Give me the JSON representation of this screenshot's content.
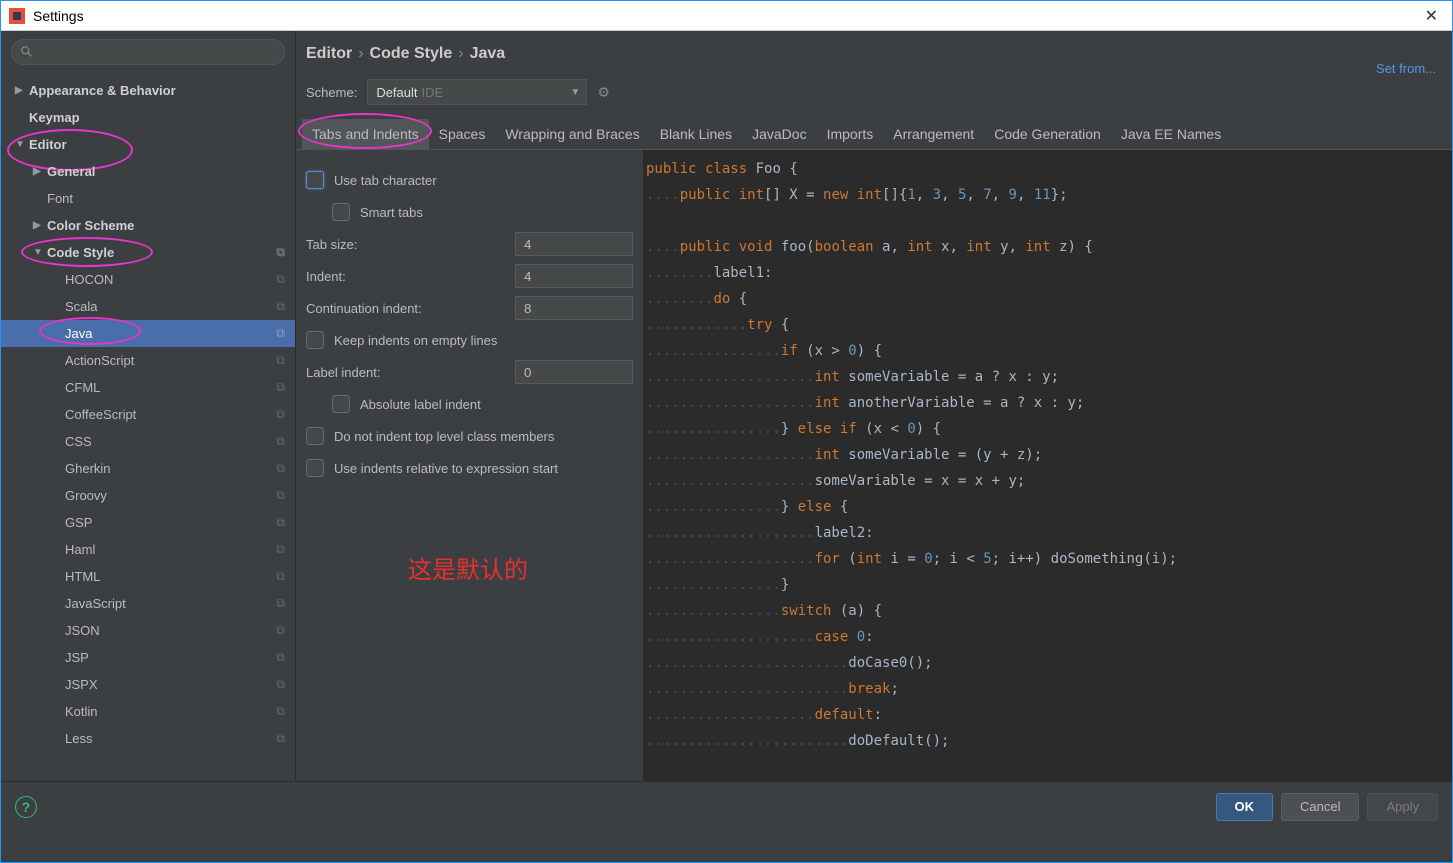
{
  "window": {
    "title": "Settings"
  },
  "breadcrumb": {
    "a": "Editor",
    "b": "Code Style",
    "c": "Java"
  },
  "scheme": {
    "label": "Scheme:",
    "value": "Default",
    "suffix": "IDE",
    "setfrom": "Set from..."
  },
  "sidebar": {
    "top": [
      {
        "label": "Appearance & Behavior",
        "arrow": "▶",
        "bold": true
      },
      {
        "label": "Keymap",
        "arrow": "",
        "bold": true
      },
      {
        "label": "Editor",
        "arrow": "▼",
        "bold": true
      }
    ],
    "editor": [
      {
        "label": "General",
        "arrow": "▶",
        "bold": true
      },
      {
        "label": "Font",
        "arrow": "",
        "bold": false
      },
      {
        "label": "Color Scheme",
        "arrow": "▶",
        "bold": true
      },
      {
        "label": "Code Style",
        "arrow": "▼",
        "bold": true,
        "copy": true
      }
    ],
    "codestyle": [
      "HOCON",
      "Scala",
      "Java",
      "ActionScript",
      "CFML",
      "CoffeeScript",
      "CSS",
      "Gherkin",
      "Groovy",
      "GSP",
      "Haml",
      "HTML",
      "JavaScript",
      "JSON",
      "JSP",
      "JSPX",
      "Kotlin",
      "Less"
    ],
    "selected": "Java"
  },
  "tabs": [
    "Tabs and Indents",
    "Spaces",
    "Wrapping and Braces",
    "Blank Lines",
    "JavaDoc",
    "Imports",
    "Arrangement",
    "Code Generation",
    "Java EE Names"
  ],
  "active_tab": "Tabs and Indents",
  "form": {
    "use_tab": "Use tab character",
    "smart_tabs": "Smart tabs",
    "tab_size_label": "Tab size:",
    "tab_size": "4",
    "indent_label": "Indent:",
    "indent": "4",
    "cont_label": "Continuation indent:",
    "cont": "8",
    "keep_empty": "Keep indents on empty lines",
    "label_indent_label": "Label indent:",
    "label_indent": "0",
    "abs_label": "Absolute label indent",
    "no_top": "Do not indent top level class members",
    "rel_expr": "Use indents relative to expression start"
  },
  "annotation": "这是默认的",
  "buttons": {
    "ok": "OK",
    "cancel": "Cancel",
    "apply": "Apply"
  },
  "code": {
    "l1": "public class Foo {",
    "l2a": "public int",
    "l2b": "X =",
    "l2c": "new int",
    "l2n": [
      "1",
      "3",
      "5",
      "7",
      "9",
      "11"
    ],
    "l3a": "public void",
    "l3b": "foo(",
    "l3c": "boolean",
    "l3d": "a,",
    "l3e": "int",
    "l3f": "x,",
    "l3g": "int",
    "l3h": "y,",
    "l3i": "int",
    "l3j": "z) {",
    "l4": "label1:",
    "l5a": "do",
    "l5b": "{",
    "l6a": "try",
    "l6b": "{",
    "l7a": "if",
    "l7b": "(x >",
    "l7c": "0",
    "l7d": ") {",
    "l8a": "int",
    "l8b": "someVariable = a ? x : y;",
    "l9a": "int",
    "l9b": "anotherVariable = a ? x : y;",
    "l10a": "}",
    "l10b": "else if",
    "l10c": "(x <",
    "l10d": "0",
    "l10e": ") {",
    "l11a": "int",
    "l11b": "someVariable = (y + z);",
    "l12": "someVariable = x = x + y;",
    "l13a": "}",
    "l13b": "else",
    "l13c": "{",
    "l14": "label2:",
    "l15a": "for",
    "l15b": "(",
    "l15c": "int",
    "l15d": "i =",
    "l15e": "0",
    "l15f": "; i <",
    "l15g": "5",
    "l15h": "; i++) doSomething(i);",
    "l16": "}",
    "l17a": "switch",
    "l17b": "(a) {",
    "l18a": "case",
    "l18b": "0",
    "l18c": ":",
    "l19": "doCase0();",
    "l20a": "break",
    "l20b": ";",
    "l21a": "default",
    "l21b": ":",
    "l22": "doDefault();"
  }
}
